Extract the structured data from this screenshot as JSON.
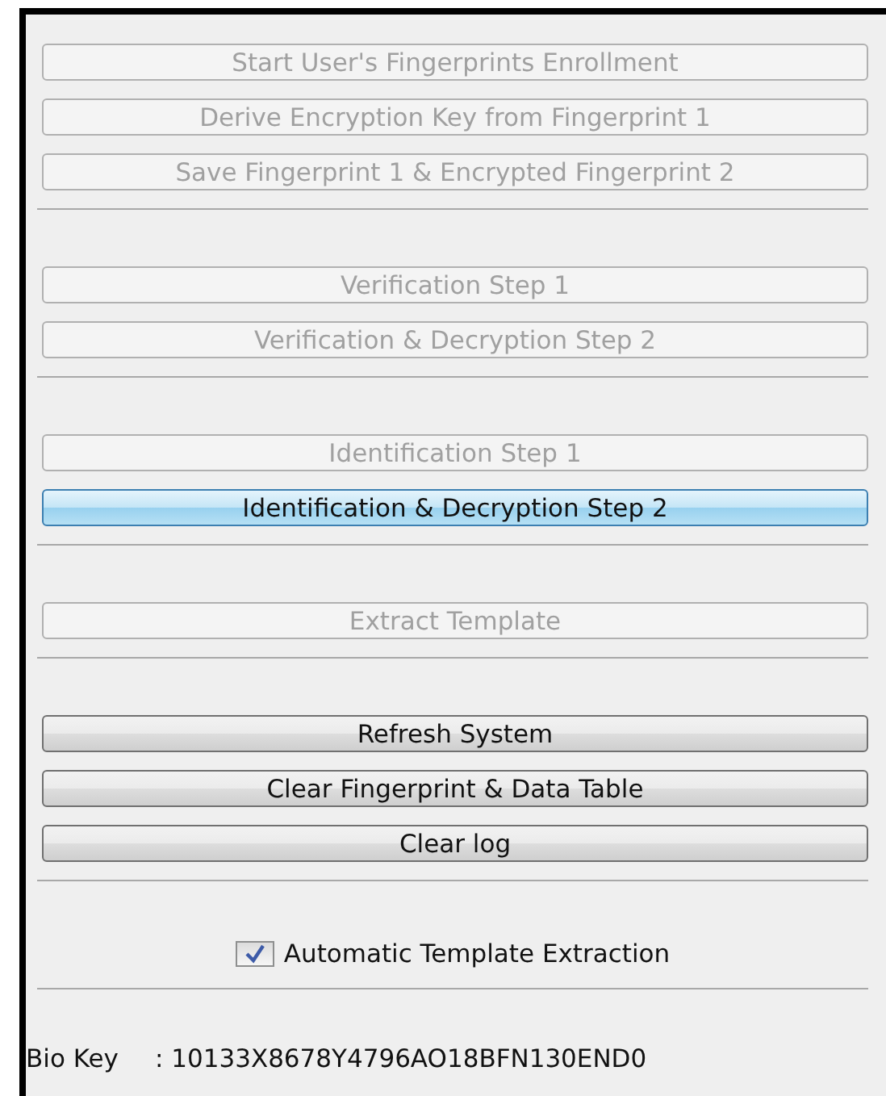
{
  "sections": [
    {
      "buttons": [
        {
          "label": "Start User's Fingerprints Enrollment",
          "disabled": true,
          "focused": false
        },
        {
          "label": "Derive Encryption Key from Fingerprint 1",
          "disabled": true,
          "focused": false
        },
        {
          "label": "Save Fingerprint 1 & Encrypted Fingerprint 2",
          "disabled": true,
          "focused": false
        }
      ]
    },
    {
      "buttons": [
        {
          "label": "Verification Step 1",
          "disabled": true,
          "focused": false
        },
        {
          "label": "Verification & Decryption Step 2",
          "disabled": true,
          "focused": false
        }
      ]
    },
    {
      "buttons": [
        {
          "label": "Identification Step 1",
          "disabled": true,
          "focused": false
        },
        {
          "label": "Identification & Decryption Step 2",
          "disabled": false,
          "focused": true
        }
      ]
    },
    {
      "buttons": [
        {
          "label": "Extract Template",
          "disabled": true,
          "focused": false
        }
      ]
    },
    {
      "buttons": [
        {
          "label": "Refresh System",
          "disabled": false,
          "focused": false
        },
        {
          "label": "Clear Fingerprint & Data Table",
          "disabled": false,
          "focused": false
        },
        {
          "label": "Clear log",
          "disabled": false,
          "focused": false
        }
      ]
    }
  ],
  "option": {
    "label": "Automatic Template Extraction",
    "checked": true
  },
  "bio_key": {
    "label": "Bio Key",
    "value": ": 10133X8678Y4796AO18BFN130END0"
  }
}
